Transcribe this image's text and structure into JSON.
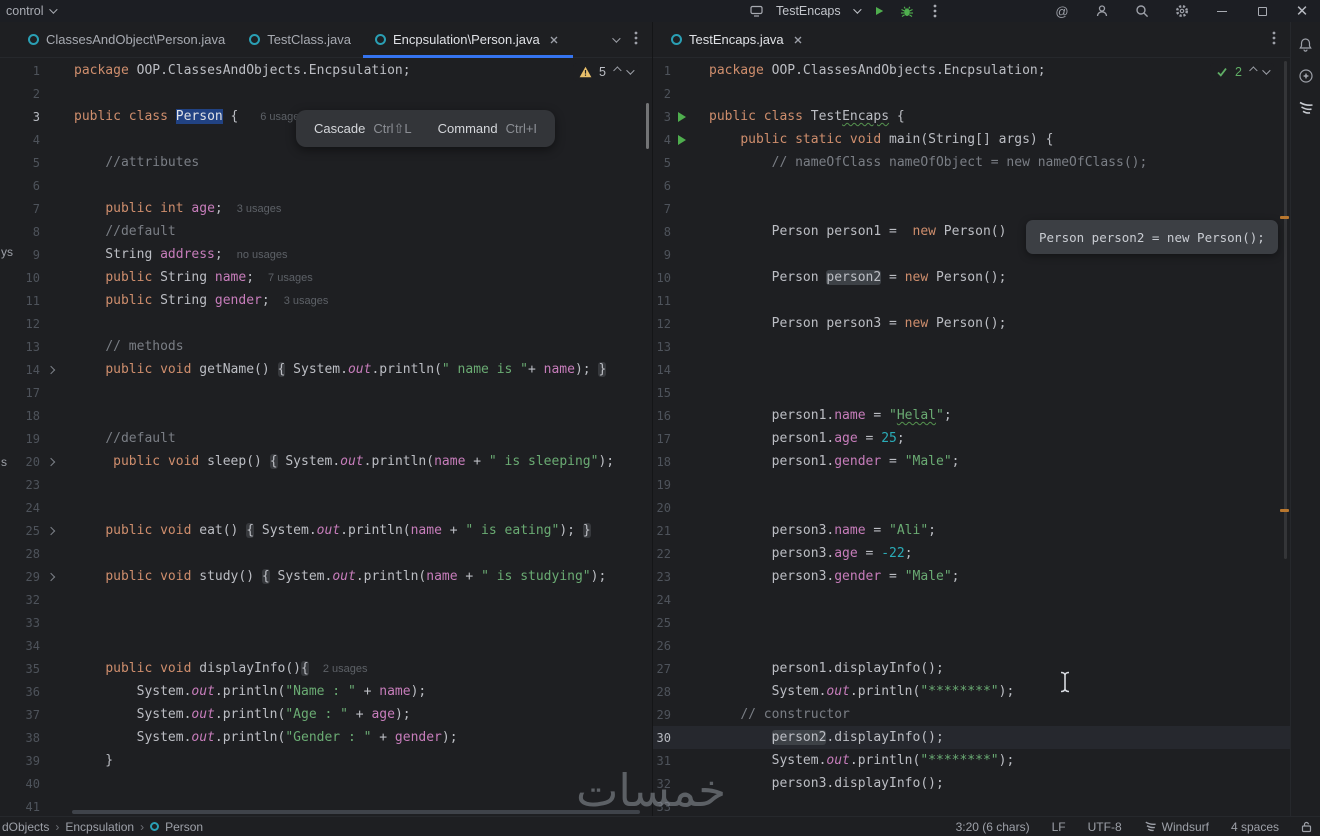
{
  "theme": {
    "accent_blue": "#3574f0",
    "run_green": "#4fae4e",
    "warning_yellow": "#e8bf6a",
    "keyword": "#cf8e6d",
    "string": "#6aab73",
    "number": "#2aacb8",
    "field": "#c77dbb",
    "comment": "#7a7e85",
    "selection": "#214283",
    "class_icon_teal": "#2a9fb4"
  },
  "titlebar": {
    "left_label": "control",
    "project": "TestEncaps"
  },
  "left_tabs": {
    "tabs": [
      {
        "label": "ClassesAndObject\\Person.java"
      },
      {
        "label": "TestClass.java"
      },
      {
        "label": "Encpsulation\\Person.java"
      }
    ]
  },
  "right_tabs": {
    "tabs": [
      {
        "label": "TestEncaps.java"
      }
    ]
  },
  "cascade_popup": {
    "cascade": "Cascade",
    "cascade_key": "Ctrl⇧L",
    "command": "Command",
    "command_key": "Ctrl+I"
  },
  "inline_tooltip": "Person person2 = new Person();",
  "left_widget": {
    "count": "5"
  },
  "right_widget": {
    "count": "2"
  },
  "left_editor": {
    "lines": [
      {
        "n": "1",
        "seg": [
          [
            "k",
            "package"
          ],
          [
            "p",
            " OOP.ClassesAndObjects.Encpsulation;"
          ]
        ]
      },
      {
        "n": "2",
        "seg": []
      },
      {
        "n": "3",
        "bright": true,
        "seg": [
          [
            "k",
            "public"
          ],
          [
            "p",
            " "
          ],
          [
            "k",
            "class"
          ],
          [
            "p",
            " "
          ],
          [
            "sel",
            "Person"
          ],
          [
            "p",
            " { "
          ],
          [
            "hint",
            "6 usages"
          ]
        ]
      },
      {
        "n": "4",
        "seg": []
      },
      {
        "n": "5",
        "seg": [
          [
            "p",
            "    "
          ],
          [
            "c",
            "//attributes"
          ]
        ]
      },
      {
        "n": "6",
        "seg": []
      },
      {
        "n": "7",
        "seg": [
          [
            "p",
            "    "
          ],
          [
            "k",
            "public"
          ],
          [
            "p",
            " "
          ],
          [
            "k",
            "int"
          ],
          [
            "p",
            " "
          ],
          [
            "f",
            "age"
          ],
          [
            "p",
            ";"
          ],
          [
            "hint",
            "3 usages"
          ]
        ]
      },
      {
        "n": "8",
        "seg": [
          [
            "p",
            "    "
          ],
          [
            "c",
            "//default"
          ]
        ]
      },
      {
        "n": "9",
        "seg": [
          [
            "p",
            "    String "
          ],
          [
            "f",
            "address"
          ],
          [
            "p",
            ";"
          ],
          [
            "hint",
            "no usages"
          ]
        ]
      },
      {
        "n": "10",
        "seg": [
          [
            "p",
            "    "
          ],
          [
            "k",
            "public"
          ],
          [
            "p",
            " String "
          ],
          [
            "f",
            "name"
          ],
          [
            "p",
            ";"
          ],
          [
            "hint",
            "7 usages"
          ]
        ]
      },
      {
        "n": "11",
        "seg": [
          [
            "p",
            "    "
          ],
          [
            "k",
            "public"
          ],
          [
            "p",
            " String "
          ],
          [
            "f",
            "gender"
          ],
          [
            "p",
            ";"
          ],
          [
            "hint",
            "3 usages"
          ]
        ]
      },
      {
        "n": "12",
        "seg": []
      },
      {
        "n": "13",
        "seg": [
          [
            "p",
            "    "
          ],
          [
            "c",
            "// methods"
          ]
        ]
      },
      {
        "n": "14",
        "fold": true,
        "seg": [
          [
            "p",
            "    "
          ],
          [
            "k",
            "public"
          ],
          [
            "p",
            " "
          ],
          [
            "k",
            "void"
          ],
          [
            "p",
            " getName() "
          ],
          [
            "br",
            "{"
          ],
          [
            "p",
            " System."
          ],
          [
            "fi",
            "out"
          ],
          [
            "p",
            ".println("
          ],
          [
            "s",
            "\" name is \""
          ],
          [
            "p",
            "+ "
          ],
          [
            "f",
            "name"
          ],
          [
            "p",
            "); "
          ],
          [
            "br",
            "}"
          ]
        ]
      },
      {
        "n": "17",
        "seg": []
      },
      {
        "n": "18",
        "seg": []
      },
      {
        "n": "19",
        "seg": [
          [
            "p",
            "    "
          ],
          [
            "c",
            "//default"
          ]
        ]
      },
      {
        "n": "20",
        "fold": true,
        "seg": [
          [
            "p",
            "     "
          ],
          [
            "k",
            "public"
          ],
          [
            "p",
            " "
          ],
          [
            "k",
            "void"
          ],
          [
            "p",
            " sleep() "
          ],
          [
            "br",
            "{"
          ],
          [
            "p",
            " System."
          ],
          [
            "fi",
            "out"
          ],
          [
            "p",
            ".println("
          ],
          [
            "f",
            "name"
          ],
          [
            "p",
            " + "
          ],
          [
            "s",
            "\" is sleeping\""
          ],
          [
            "p",
            ");"
          ]
        ]
      },
      {
        "n": "23",
        "seg": []
      },
      {
        "n": "24",
        "seg": []
      },
      {
        "n": "25",
        "fold": true,
        "seg": [
          [
            "p",
            "    "
          ],
          [
            "k",
            "public"
          ],
          [
            "p",
            " "
          ],
          [
            "k",
            "void"
          ],
          [
            "p",
            " eat() "
          ],
          [
            "br",
            "{"
          ],
          [
            "p",
            " System."
          ],
          [
            "fi",
            "out"
          ],
          [
            "p",
            ".println("
          ],
          [
            "f",
            "name"
          ],
          [
            "p",
            " + "
          ],
          [
            "s",
            "\" is eating\""
          ],
          [
            "p",
            "); "
          ],
          [
            "br",
            "}"
          ]
        ]
      },
      {
        "n": "28",
        "seg": []
      },
      {
        "n": "29",
        "fold": true,
        "seg": [
          [
            "p",
            "    "
          ],
          [
            "k",
            "public"
          ],
          [
            "p",
            " "
          ],
          [
            "k",
            "void"
          ],
          [
            "p",
            " study() "
          ],
          [
            "br",
            "{"
          ],
          [
            "p",
            " System."
          ],
          [
            "fi",
            "out"
          ],
          [
            "p",
            ".println("
          ],
          [
            "f",
            "name"
          ],
          [
            "p",
            " + "
          ],
          [
            "s",
            "\" is studying\""
          ],
          [
            "p",
            ");"
          ]
        ]
      },
      {
        "n": "32",
        "seg": []
      },
      {
        "n": "33",
        "seg": []
      },
      {
        "n": "34",
        "seg": []
      },
      {
        "n": "35",
        "seg": [
          [
            "p",
            "    "
          ],
          [
            "k",
            "public"
          ],
          [
            "p",
            " "
          ],
          [
            "k",
            "void"
          ],
          [
            "p",
            " displayInfo()"
          ],
          [
            "br",
            "{"
          ],
          [
            "hint",
            "2 usages"
          ]
        ]
      },
      {
        "n": "36",
        "seg": [
          [
            "p",
            "        System."
          ],
          [
            "fi",
            "out"
          ],
          [
            "p",
            ".println("
          ],
          [
            "s",
            "\"Name : \""
          ],
          [
            "p",
            " + "
          ],
          [
            "f",
            "name"
          ],
          [
            "p",
            ");"
          ]
        ]
      },
      {
        "n": "37",
        "seg": [
          [
            "p",
            "        System."
          ],
          [
            "fi",
            "out"
          ],
          [
            "p",
            ".println("
          ],
          [
            "s",
            "\"Age : \""
          ],
          [
            "p",
            " + "
          ],
          [
            "f",
            "age"
          ],
          [
            "p",
            ");"
          ]
        ]
      },
      {
        "n": "38",
        "seg": [
          [
            "p",
            "        System."
          ],
          [
            "fi",
            "out"
          ],
          [
            "p",
            ".println("
          ],
          [
            "s",
            "\"Gender : \""
          ],
          [
            "p",
            " + "
          ],
          [
            "f",
            "gender"
          ],
          [
            "p",
            ");"
          ]
        ]
      },
      {
        "n": "39",
        "seg": [
          [
            "p",
            "    }"
          ]
        ]
      },
      {
        "n": "40",
        "seg": []
      },
      {
        "n": "41",
        "seg": []
      }
    ]
  },
  "right_editor": {
    "lines": [
      {
        "n": "1",
        "seg": [
          [
            "k",
            "package"
          ],
          [
            "p",
            " OOP.ClassesAndObjects.Encpsulation;"
          ]
        ]
      },
      {
        "n": "2",
        "seg": []
      },
      {
        "n": "3",
        "run": true,
        "seg": [
          [
            "k",
            "public"
          ],
          [
            "p",
            " "
          ],
          [
            "k",
            "class"
          ],
          [
            "p",
            " Test"
          ],
          [
            "wavy",
            "Encaps"
          ],
          [
            "p",
            " {"
          ]
        ]
      },
      {
        "n": "4",
        "run": true,
        "seg": [
          [
            "p",
            "    "
          ],
          [
            "k",
            "public"
          ],
          [
            "p",
            " "
          ],
          [
            "k",
            "static"
          ],
          [
            "p",
            " "
          ],
          [
            "k",
            "void"
          ],
          [
            "p",
            " main(String[] args) {"
          ]
        ]
      },
      {
        "n": "5",
        "seg": [
          [
            "p",
            "        "
          ],
          [
            "c",
            "// nameOfClass nameOfObject = new nameOfClass();"
          ]
        ]
      },
      {
        "n": "6",
        "seg": []
      },
      {
        "n": "7",
        "seg": []
      },
      {
        "n": "8",
        "seg": [
          [
            "p",
            "        Person person1 =  "
          ],
          [
            "k",
            "new"
          ],
          [
            "p",
            " Person()"
          ]
        ]
      },
      {
        "n": "9",
        "seg": []
      },
      {
        "n": "10",
        "seg": [
          [
            "p",
            "        Person "
          ],
          [
            "hl",
            "person2"
          ],
          [
            "p",
            " = "
          ],
          [
            "k",
            "new"
          ],
          [
            "p",
            " Person();"
          ]
        ]
      },
      {
        "n": "11",
        "seg": []
      },
      {
        "n": "12",
        "seg": [
          [
            "p",
            "        Person person3 = "
          ],
          [
            "k",
            "new"
          ],
          [
            "p",
            " Person();"
          ]
        ]
      },
      {
        "n": "13",
        "seg": []
      },
      {
        "n": "14",
        "seg": []
      },
      {
        "n": "15",
        "seg": []
      },
      {
        "n": "16",
        "seg": [
          [
            "p",
            "        person1."
          ],
          [
            "f",
            "name"
          ],
          [
            "p",
            " = "
          ],
          [
            "s",
            "\""
          ],
          [
            "su",
            "Helal"
          ],
          [
            "s",
            "\""
          ],
          [
            "p",
            ";"
          ]
        ]
      },
      {
        "n": "17",
        "seg": [
          [
            "p",
            "        person1."
          ],
          [
            "f",
            "age"
          ],
          [
            "p",
            " = "
          ],
          [
            "n",
            "25"
          ],
          [
            "p",
            ";"
          ]
        ]
      },
      {
        "n": "18",
        "seg": [
          [
            "p",
            "        person1."
          ],
          [
            "f",
            "gender"
          ],
          [
            "p",
            " = "
          ],
          [
            "s",
            "\"Male\""
          ],
          [
            "p",
            ";"
          ]
        ]
      },
      {
        "n": "19",
        "seg": []
      },
      {
        "n": "20",
        "seg": []
      },
      {
        "n": "21",
        "seg": [
          [
            "p",
            "        person3."
          ],
          [
            "f",
            "name"
          ],
          [
            "p",
            " = "
          ],
          [
            "s",
            "\"Ali\""
          ],
          [
            "p",
            ";"
          ]
        ]
      },
      {
        "n": "22",
        "seg": [
          [
            "p",
            "        person3."
          ],
          [
            "f",
            "age"
          ],
          [
            "p",
            " = "
          ],
          [
            "n",
            "-22"
          ],
          [
            "p",
            ";"
          ]
        ]
      },
      {
        "n": "23",
        "seg": [
          [
            "p",
            "        person3."
          ],
          [
            "f",
            "gender"
          ],
          [
            "p",
            " = "
          ],
          [
            "s",
            "\"Male\""
          ],
          [
            "p",
            ";"
          ]
        ]
      },
      {
        "n": "24",
        "seg": []
      },
      {
        "n": "25",
        "seg": []
      },
      {
        "n": "26",
        "seg": []
      },
      {
        "n": "27",
        "seg": [
          [
            "p",
            "        person1.displayInfo();"
          ]
        ]
      },
      {
        "n": "28",
        "seg": [
          [
            "p",
            "        System."
          ],
          [
            "fi",
            "out"
          ],
          [
            "p",
            ".println("
          ],
          [
            "s",
            "\"********\""
          ],
          [
            "p",
            ");"
          ]
        ]
      },
      {
        "n": "29",
        "seg": [
          [
            "p",
            "    "
          ],
          [
            "c",
            "// constructor"
          ]
        ]
      },
      {
        "n": "30",
        "current": true,
        "bright": true,
        "seg": [
          [
            "p",
            "        "
          ],
          [
            "hl",
            "person2"
          ],
          [
            "p",
            ".displayInfo();"
          ]
        ]
      },
      {
        "n": "31",
        "seg": [
          [
            "p",
            "        System."
          ],
          [
            "fi",
            "out"
          ],
          [
            "p",
            ".println("
          ],
          [
            "s",
            "\"********\""
          ],
          [
            "p",
            ");"
          ]
        ]
      },
      {
        "n": "32",
        "seg": [
          [
            "p",
            "        person3.displayInfo();"
          ]
        ]
      },
      {
        "n": "33",
        "seg": []
      }
    ]
  },
  "statusbar": {
    "crumb1": "dObjects",
    "crumb2": "Encpsulation",
    "crumb3": "Person",
    "sep": "›",
    "caret": "3:20 (6 chars)",
    "eol": "LF",
    "enc": "UTF-8",
    "plugin": "Windsurf",
    "indent": "4 spaces"
  },
  "watermark": "خمسات",
  "edge_fragments": {
    "a": "ys",
    "b": "s"
  }
}
